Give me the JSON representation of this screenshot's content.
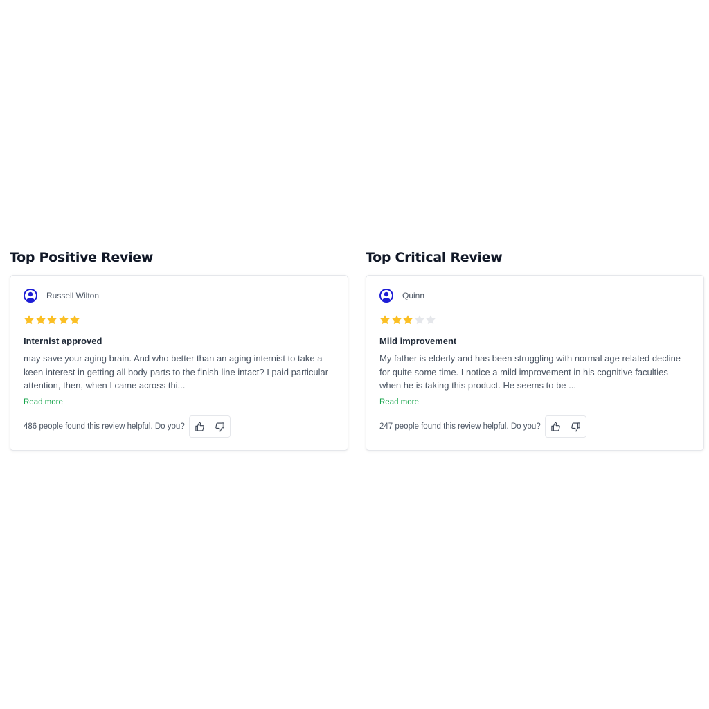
{
  "colors": {
    "star_filled": "#fbbf24",
    "star_empty": "#e5e7eb",
    "avatar": "#1d1dd6",
    "read_more": "#16a34a"
  },
  "reviews": [
    {
      "heading": "Top Positive Review",
      "reviewer": "Russell Wilton",
      "rating": 5,
      "max_rating": 5,
      "title": "Internist approved",
      "body": "may save your aging brain. And who better than an aging internist to take a keen interest in getting all body parts to the finish line intact? I paid particular attention, then, when I came across thi...",
      "read_more": "Read more",
      "helpful_text": "486 people found this review helpful. Do you?",
      "thumbs_up_icon": "thumbs-up-icon",
      "thumbs_down_icon": "thumbs-down-icon"
    },
    {
      "heading": "Top Critical Review",
      "reviewer": "Quinn",
      "rating": 3,
      "max_rating": 5,
      "title": "Mild improvement",
      "body": "My father is elderly and has been struggling with normal age related decline for quite some time. I notice a mild improvement in his cognitive faculties when he is taking this product. He seems to be ...",
      "read_more": "Read more",
      "helpful_text": "247 people found this review helpful. Do you?",
      "thumbs_up_icon": "thumbs-up-icon",
      "thumbs_down_icon": "thumbs-down-icon"
    }
  ]
}
